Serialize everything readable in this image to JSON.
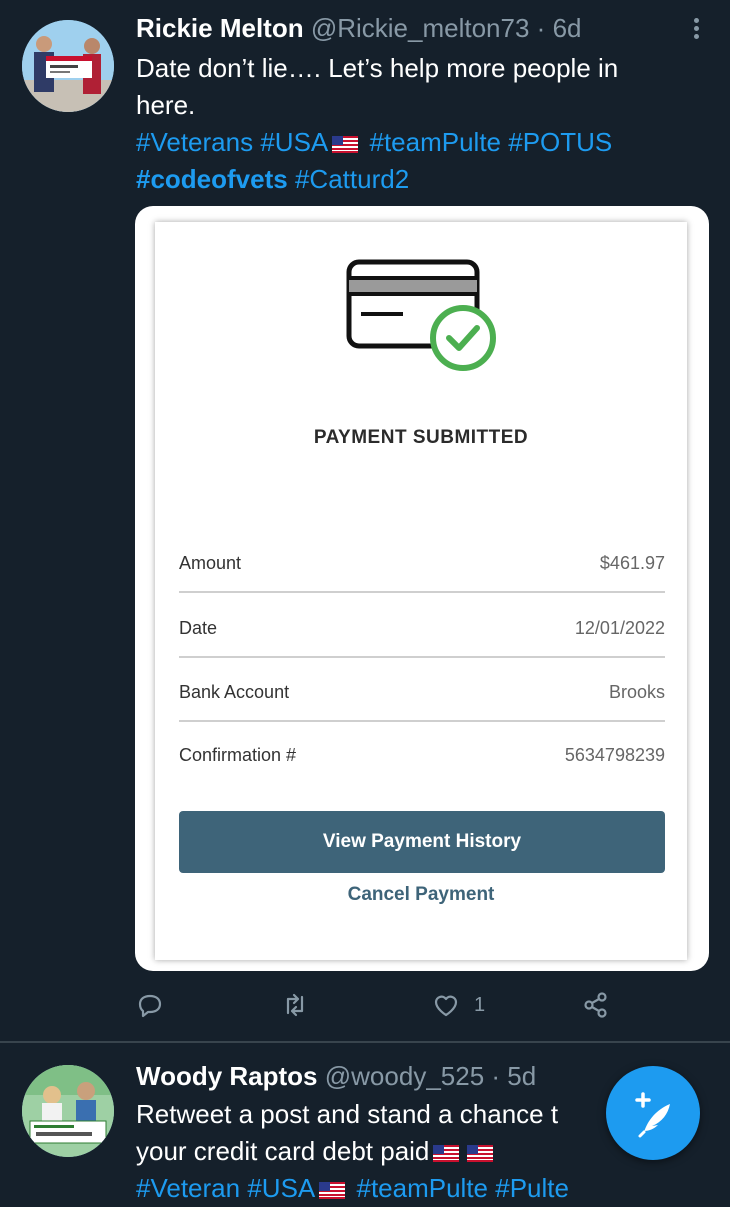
{
  "tweets": [
    {
      "name": "Rickie Melton",
      "handle": "@Rickie_melton73",
      "sep": "·",
      "time": "6d",
      "text_lines": [
        "Date don’t lie…. Let’s help more people in",
        "here."
      ],
      "hashtags_line1": [
        "#Veterans",
        "#USA",
        "#teamPulte",
        "#POTUS"
      ],
      "hashtags_line2": [
        "#codeofvets",
        "#Catturd2"
      ],
      "payment": {
        "title": "PAYMENT SUBMITTED",
        "rows": [
          {
            "label": "Amount",
            "value": "$461.97"
          },
          {
            "label": "Date",
            "value": "12/01/2022"
          },
          {
            "label": "Bank Account",
            "value": "Brooks"
          },
          {
            "label": "Confirmation #",
            "value": "5634798239"
          }
        ],
        "primary_button": "View Payment History",
        "secondary_button": "Cancel Payment"
      },
      "actions": {
        "like_count": "1"
      }
    },
    {
      "name": "Woody Raptos",
      "handle": "@woody_525",
      "sep": "·",
      "time": "5d",
      "text_line1": "Retweet a post and stand a chance t",
      "text_line2": "your credit card debt paid",
      "hashtags_line1": [
        "#Veteran",
        "#USA",
        "#teamPulte",
        "#Pulte"
      ]
    }
  ],
  "colors": {
    "background": "#15202b",
    "accent": "#1d9bf0",
    "muted": "#8899a6",
    "payment_button": "#3e6479",
    "check_green": "#4caf50"
  },
  "icons": [
    "reply-icon",
    "retweet-icon",
    "like-icon",
    "share-icon",
    "more-icon",
    "compose-tweet-icon",
    "us-flag-icon",
    "credit-card-check-icon"
  ]
}
